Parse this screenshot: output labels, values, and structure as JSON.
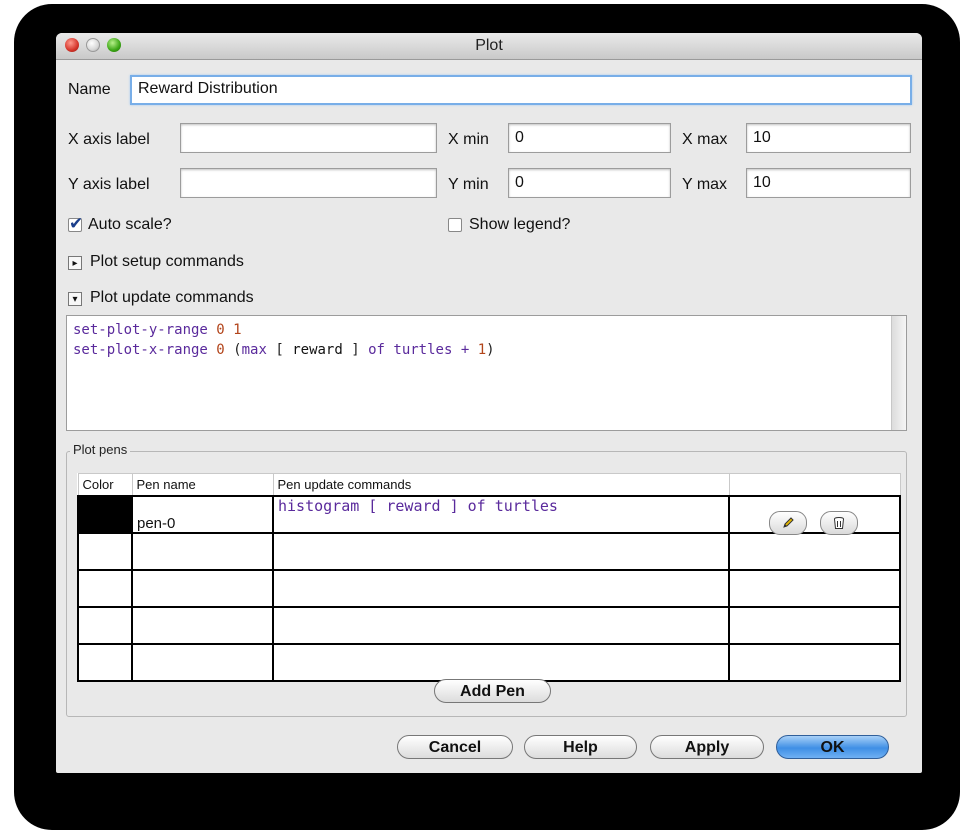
{
  "window": {
    "title": "Plot"
  },
  "name": {
    "label": "Name",
    "value": "Reward Distribution"
  },
  "x_axis": {
    "label": "X axis label",
    "value": "",
    "min_label": "X min",
    "min_value": "0",
    "max_label": "X max",
    "max_value": "10"
  },
  "y_axis": {
    "label": "Y axis label",
    "value": "",
    "min_label": "Y min",
    "min_value": "0",
    "max_label": "Y max",
    "max_value": "10"
  },
  "options": {
    "auto_scale_label": "Auto scale?",
    "auto_scale_checked": true,
    "show_legend_label": "Show legend?",
    "show_legend_checked": false
  },
  "setup_commands": {
    "label": "Plot setup commands",
    "expanded": false
  },
  "update_commands": {
    "label": "Plot update commands",
    "expanded": true,
    "lines": [
      "set-plot-y-range 0 1",
      "set-plot-x-range 0 (max [ reward ] of turtles + 1)"
    ]
  },
  "pens": {
    "group_label": "Plot pens",
    "columns": [
      "Color",
      "Pen name",
      "Pen update commands"
    ],
    "rows": [
      {
        "color": "#000000",
        "name": "pen-0",
        "commands": "histogram [ reward ] of turtles"
      }
    ],
    "empty_rows": 4,
    "add_pen_label": "Add Pen"
  },
  "buttons": {
    "cancel": "Cancel",
    "help": "Help",
    "apply": "Apply",
    "ok": "OK"
  },
  "icons": {
    "edit": "pencil-icon",
    "delete": "trash-icon"
  }
}
